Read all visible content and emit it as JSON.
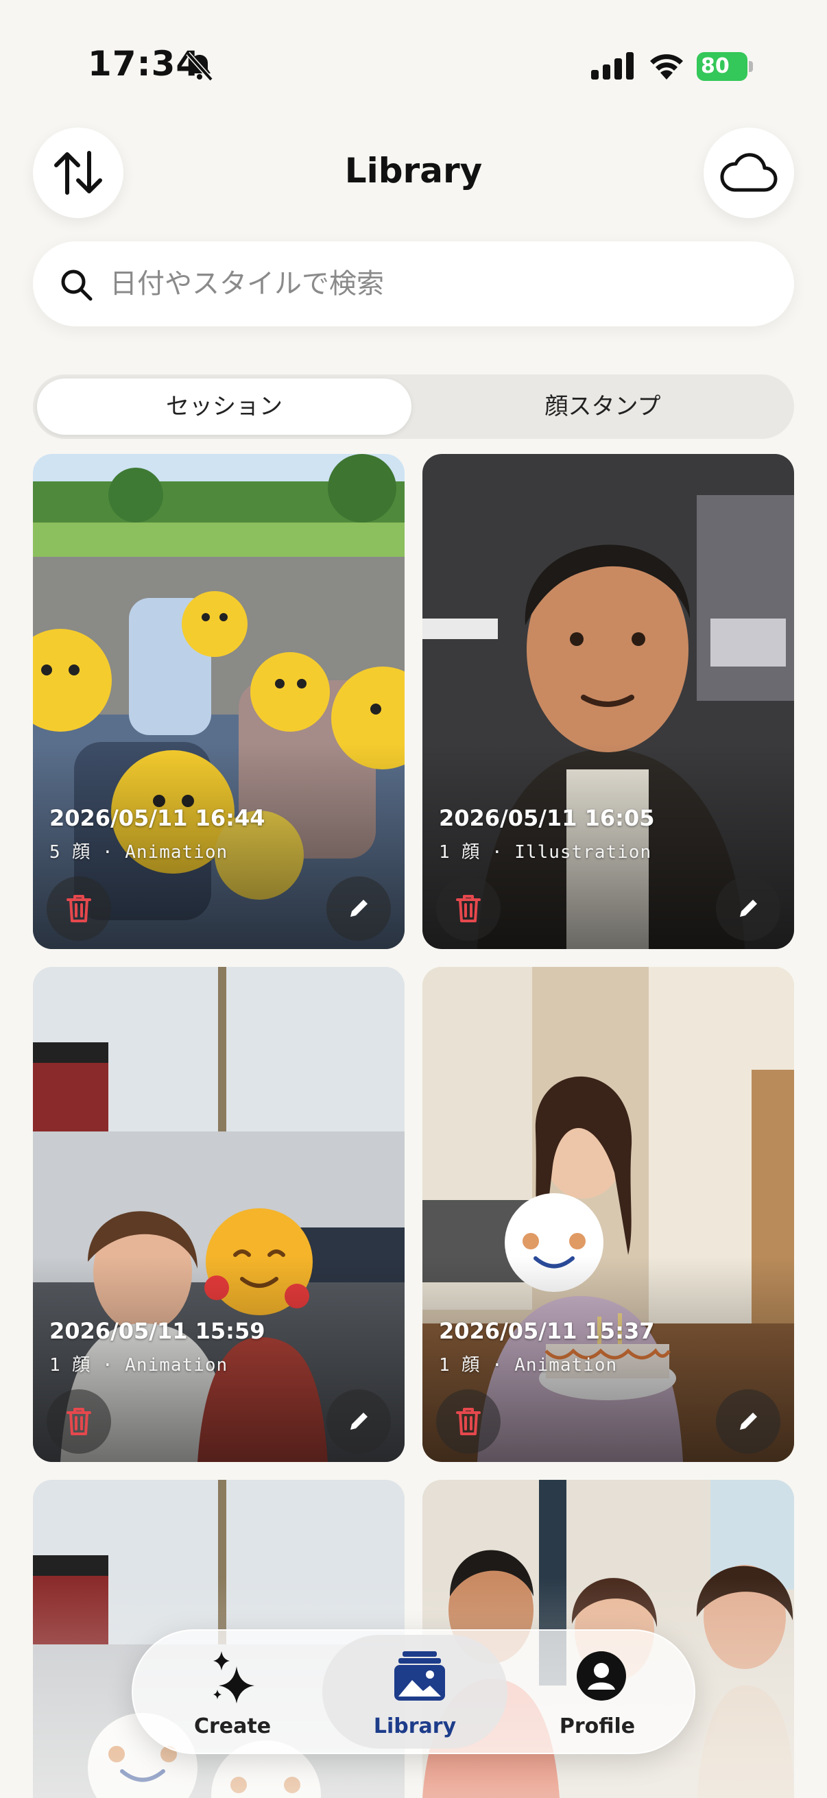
{
  "status_bar": {
    "time": "17:34",
    "battery": "80"
  },
  "header": {
    "title": "Library",
    "sort_icon": "sort-arrows-icon",
    "cloud_icon": "cloud-icon"
  },
  "search": {
    "placeholder": "日付やスタイルで検索"
  },
  "segments": [
    {
      "label": "セッション",
      "active": true
    },
    {
      "label": "顔スタンプ",
      "active": false
    }
  ],
  "sessions": [
    {
      "date": "2026/05/11 16:44",
      "meta": "5 顔 · Animation"
    },
    {
      "date": "2026/05/11 16:05",
      "meta": "1 顔 · Illustration"
    },
    {
      "date": "2026/05/11 15:59",
      "meta": "1 顔 · Animation"
    },
    {
      "date": "2026/05/11 15:37",
      "meta": "1 顔 · Animation"
    }
  ],
  "tabbar": [
    {
      "label": "Create",
      "icon": "sparkles-icon",
      "active": false
    },
    {
      "label": "Library",
      "icon": "photo-stack-icon",
      "active": true
    },
    {
      "label": "Profile",
      "icon": "person-circle-icon",
      "active": false
    }
  ],
  "colors": {
    "accent": "#1d3c8a",
    "delete": "#e5484d",
    "battery": "#34c759",
    "background": "#f7f6f2"
  }
}
